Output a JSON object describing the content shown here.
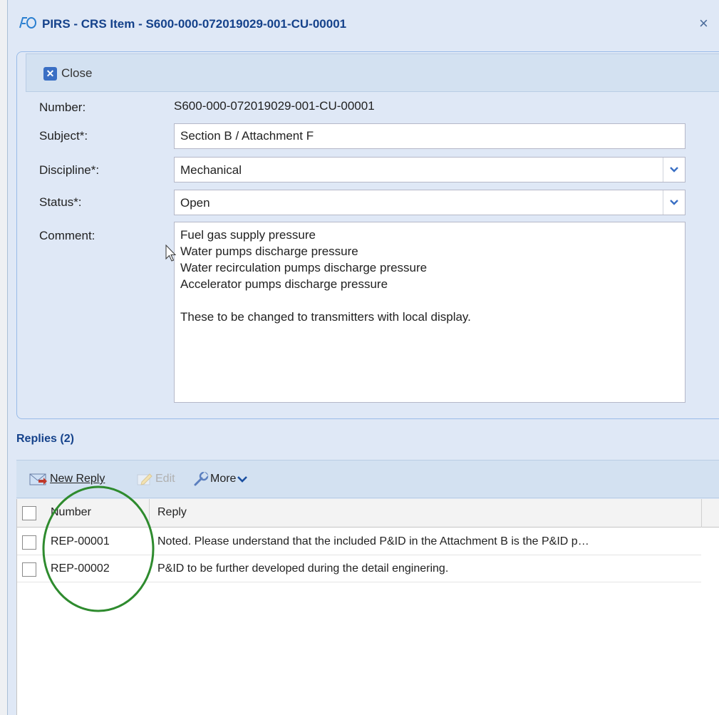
{
  "window": {
    "title": "PIRS - CRS Item - S600-000-072019029-001-CU-00001",
    "close_symbol": "×"
  },
  "toolbar": {
    "close_label": "Close",
    "close_icon": "close-icon"
  },
  "form": {
    "number_label": "Number:",
    "number_value": "S600-000-072019029-001-CU-00001",
    "subject_label": "Subject*:",
    "subject_value": "Section B / Attachment F",
    "discipline_label": "Discipline*:",
    "discipline_value": "Mechanical",
    "status_label": "Status*:",
    "status_value": "Open",
    "comment_label": "Comment:",
    "comment_lines": [
      "Fuel gas supply pressure",
      "Water pumps discharge pressure",
      "Water recirculation pumps discharge pressure",
      "Accelerator pumps discharge pressure",
      "",
      "These to be changed to transmitters with local display."
    ]
  },
  "replies": {
    "header": "Replies (2)",
    "toolbar": {
      "new_reply": "New Reply",
      "edit": "Edit",
      "more": "More"
    },
    "columns": [
      "Number",
      "Reply"
    ],
    "rows": [
      {
        "number": "REP-00001",
        "reply": "Noted. Please understand that the included P&ID in the Attachment B is the P&ID p…"
      },
      {
        "number": "REP-00002",
        "reply": "P&ID to be further developed during the detail enginering."
      }
    ]
  },
  "colors": {
    "accent": "#15428b",
    "panel_bg": "#dfe8f6",
    "toolbar_bg": "#d3e1f1",
    "annotation": "#2e8b2e"
  }
}
